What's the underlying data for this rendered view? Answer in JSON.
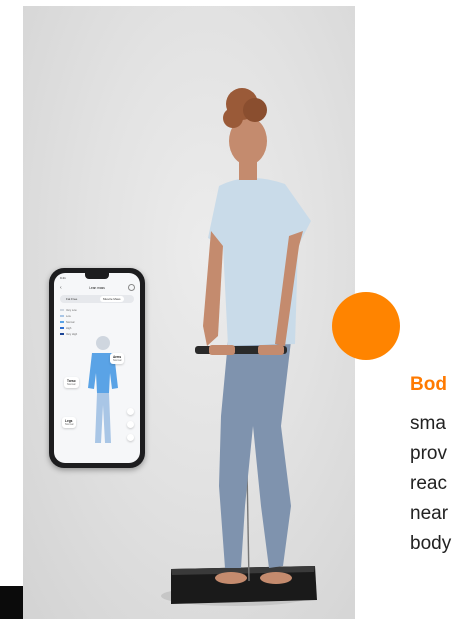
{
  "headline": "Bod",
  "body_lines": [
    "sma",
    "prov",
    "reac",
    "near",
    "body"
  ],
  "colors": {
    "accent": "#ff8400",
    "headline": "#ff7a00",
    "top_shirt": "#c9dbe9",
    "leggings": "#7f93ae",
    "background": "#e2e2e2"
  },
  "phone": {
    "time": "9:41",
    "screen_title": "Lean mass",
    "tabs": [
      {
        "label": "Fat Free",
        "active": false
      },
      {
        "label": "Muscle Mass",
        "active": true
      }
    ],
    "legend": [
      "Very Low",
      "Low",
      "Normal",
      "High",
      "Very High"
    ],
    "cards": {
      "torso": {
        "title": "Torso",
        "value": "Normal"
      },
      "arms": {
        "title": "Arms",
        "value": "Normal"
      },
      "legs": {
        "title": "Legs",
        "value": "Normal"
      }
    }
  }
}
